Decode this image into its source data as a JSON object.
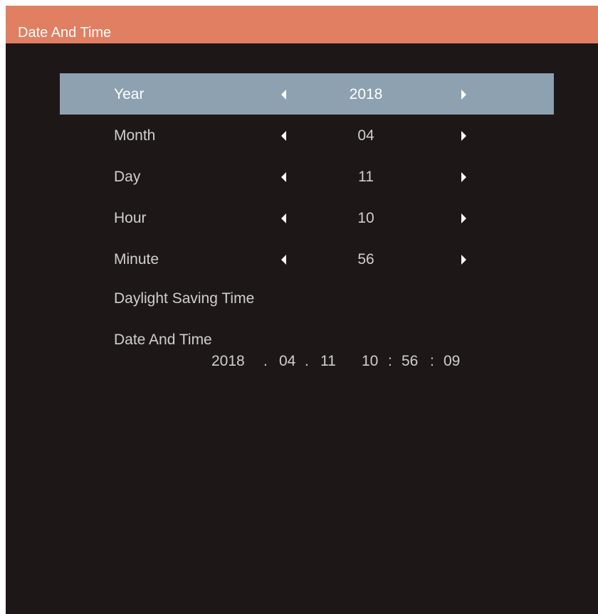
{
  "title": "Date And Time",
  "menu": {
    "rows": [
      {
        "label": "Year",
        "value": "2018",
        "selected": true
      },
      {
        "label": "Month",
        "value": "04",
        "selected": false
      },
      {
        "label": "Day",
        "value": "11",
        "selected": false
      },
      {
        "label": "Hour",
        "value": "10",
        "selected": false
      },
      {
        "label": "Minute",
        "value": "56",
        "selected": false
      }
    ],
    "daylight_saving_label": "Daylight Saving Time",
    "date_time_label": "Date And Time"
  },
  "current": {
    "year": "2018",
    "sep1": ".",
    "month": "04",
    "sep2": ".",
    "day": "11",
    "hour": "10",
    "sep3": ":",
    "minute": "56",
    "sep4": ":",
    "second": "09"
  },
  "colors": {
    "title_bar": "#e17f62",
    "background": "#1e1718",
    "selected_row": "#8da1b0",
    "text": "#cfcfcf"
  }
}
